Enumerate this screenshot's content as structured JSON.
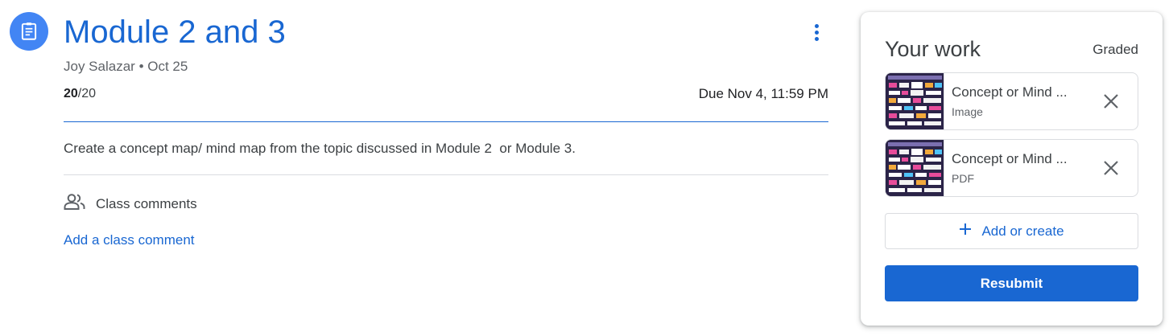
{
  "assignment": {
    "icon": "assignment-icon",
    "title": "Module 2 and 3",
    "author": "Joy Salazar",
    "separator": "•",
    "posted_date": "Oct 25",
    "points_earned": "20",
    "points_total": "/20",
    "due": "Due Nov 4, 11:59 PM",
    "instructions": "Create a concept map/ mind map from the topic discussed in Module 2  or Module 3.",
    "more_icon": "more-vert-icon"
  },
  "comments": {
    "icon": "people-icon",
    "label": "Class comments",
    "add_label": "Add a class comment"
  },
  "your_work": {
    "title": "Your work",
    "status": "Graded",
    "attachments": [
      {
        "name": "Concept or Mind ...",
        "type": "Image",
        "remove_icon": "close-icon"
      },
      {
        "name": "Concept or Mind ...",
        "type": "PDF",
        "remove_icon": "close-icon"
      }
    ],
    "add_icon": "plus-icon",
    "add_label": "Add or create",
    "resubmit_label": "Resubmit"
  },
  "colors": {
    "accent": "#1967d2",
    "icon_bg": "#4285f4",
    "text": "#3c4043",
    "muted": "#5f6368",
    "border": "#dadce0"
  }
}
